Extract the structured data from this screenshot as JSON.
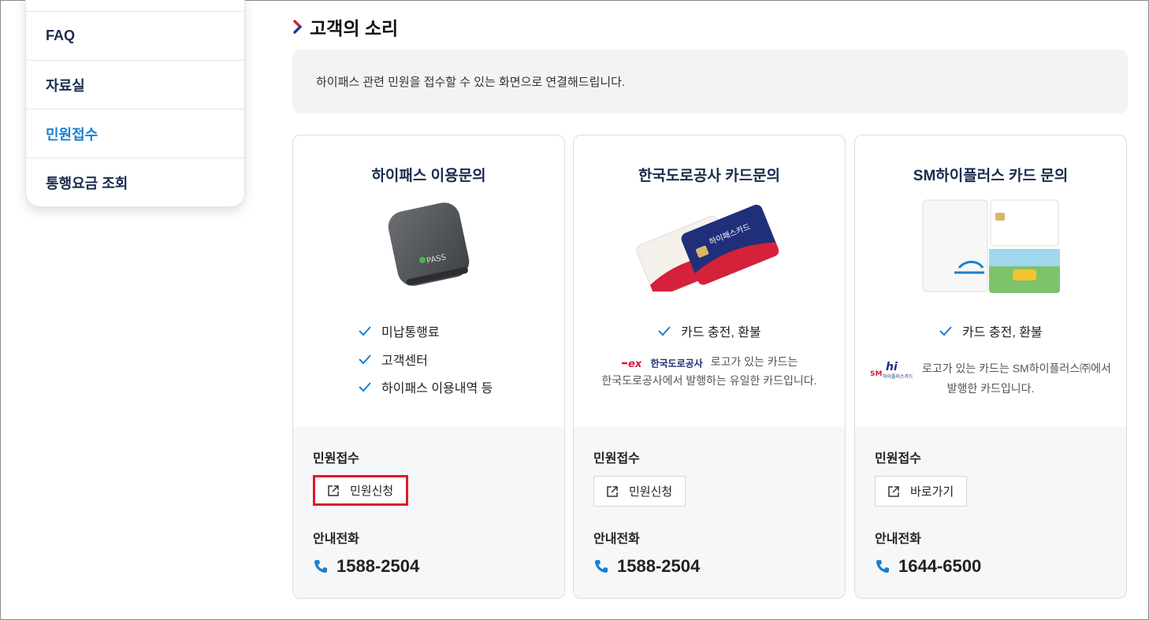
{
  "sidebar": {
    "items": [
      {
        "label": "FAQ",
        "active": false
      },
      {
        "label": "자료실",
        "active": false
      },
      {
        "label": "민원접수",
        "active": true
      },
      {
        "label": "통행요금 조회",
        "active": false
      }
    ]
  },
  "section": {
    "title": "고객의 소리",
    "intro": "하이패스 관련 민원을 접수할 수 있는 화면으로 연결해드립니다."
  },
  "cards": [
    {
      "title": "하이패스 이용문의",
      "checks": [
        "미납통행료",
        "고객센터",
        "하이패스 이용내역 등"
      ],
      "device_text": "PASS",
      "complaint_label": "민원접수",
      "button_label": "민원신청",
      "button_highlighted": true,
      "phone_label": "안내전화",
      "phone": "1588-2504"
    },
    {
      "title": "한국도로공사 카드문의",
      "checks": [
        "카드 충전, 환불"
      ],
      "note_logo_text": "한국도로공사",
      "note_line1": "로고가 있는 카드는",
      "note_line2": "한국도로공사에서 발행하는 유일한 카드입니다.",
      "card_text": "하이패스카드",
      "complaint_label": "민원접수",
      "button_label": "민원신청",
      "button_highlighted": false,
      "phone_label": "안내전화",
      "phone": "1588-2504"
    },
    {
      "title": "SM하이플러스 카드 문의",
      "checks": [
        "카드 충전, 환불"
      ],
      "note_logo_text": "하이플러스카드",
      "note_line1": "로고가 있는 카드는 SM하이플러스㈜에서",
      "note_line2": "발행한 카드입니다.",
      "complaint_label": "민원접수",
      "button_label": "바로가기",
      "button_highlighted": false,
      "phone_label": "안내전화",
      "phone": "1644-6500"
    }
  ],
  "colors": {
    "navy": "#1a2b4c",
    "accent_blue": "#1a7fd0",
    "highlight_red": "#e0182b"
  }
}
